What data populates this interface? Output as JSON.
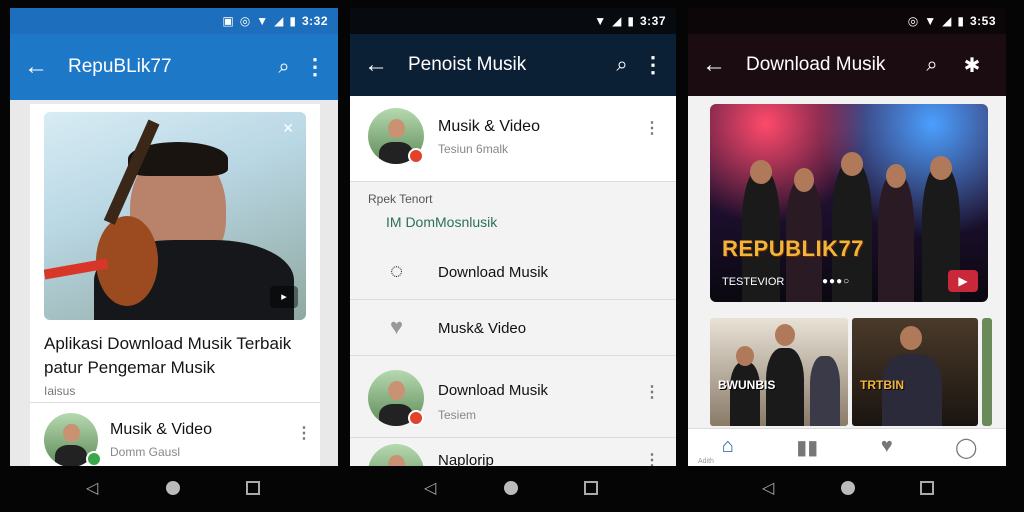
{
  "screens": [
    {
      "status": {
        "time": "3:32"
      },
      "appbar": {
        "title": "RepuBLik77",
        "back_icon": "arrow-left-icon",
        "search_icon": "search-icon",
        "more_icon": "more-vert-icon"
      },
      "featured": {
        "headline_line1": "Aplikasi Download Musik Terbaik",
        "headline_line2": "patur Pengemar Musik",
        "meta": "Iaisus"
      },
      "list": [
        {
          "title": "Musik & Video",
          "subtitle": "Domm Gausl"
        }
      ]
    },
    {
      "status": {
        "time": "3:37"
      },
      "appbar": {
        "title": "Penoist Musik",
        "back_icon": "arrow-left-icon",
        "search_icon": "search-icon",
        "more_icon": "more-vert-icon"
      },
      "items": [
        {
          "title": "Musik & Video",
          "subtitle": "Tesiun 6malk"
        }
      ],
      "section_label": "Rpek Tenort",
      "section_sub": "IM DomMosnlusik",
      "menu": [
        {
          "label": "Download Musik",
          "icon": "chat-bubble-icon"
        },
        {
          "label": "Musk& Video",
          "icon": "heart-icon"
        }
      ],
      "items2": [
        {
          "title": "Download Musik",
          "subtitle": "Tesiem"
        },
        {
          "title": "Naplorip",
          "subtitle": ""
        }
      ]
    },
    {
      "status": {
        "time": "3:53"
      },
      "appbar": {
        "title": "Download Musik",
        "back_icon": "arrow-left-icon",
        "search_icon": "search-icon",
        "alert_icon": "notification-icon"
      },
      "hero": {
        "brand": "REPUBLIK77",
        "caption": "TESTEVIOR"
      },
      "tiles": [
        {
          "text": "BWUNBIS"
        },
        {
          "text": "TRTBIN"
        }
      ],
      "bottom_nav": [
        {
          "icon": "home-icon",
          "label": "Adith"
        },
        {
          "icon": "library-icon",
          "label": ""
        },
        {
          "icon": "heart-icon",
          "label": ""
        },
        {
          "icon": "profile-icon",
          "label": ""
        }
      ]
    }
  ],
  "colors": {
    "blue": "#1e78c8",
    "navy": "#0b1f35",
    "wine": "#1b0c12",
    "accent_red": "#d83a28",
    "gold": "#f2b53a"
  }
}
